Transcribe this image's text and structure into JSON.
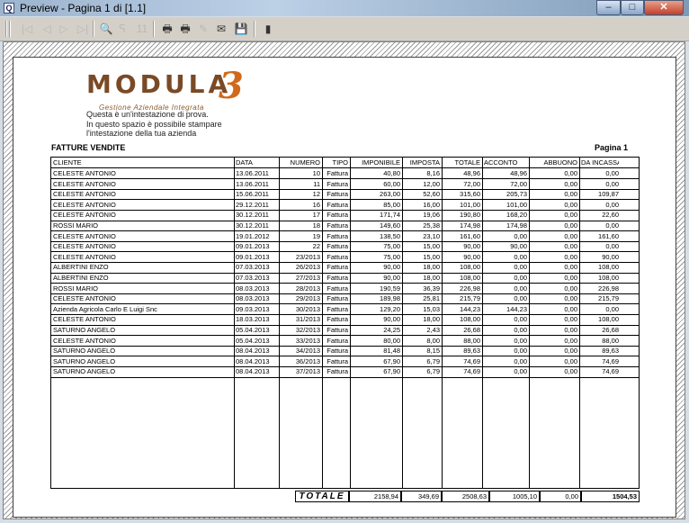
{
  "window": {
    "title": "Preview - Pagina 1 di [1.1]",
    "icon_glyph": "Q",
    "buttons": {
      "minimize": "–",
      "maximize": "□",
      "close": "✕"
    }
  },
  "toolbar": {
    "buttons": [
      {
        "name": "first-page-icon",
        "glyph": "|◁",
        "enabled": false
      },
      {
        "name": "prev-page-icon",
        "glyph": "◁",
        "enabled": false
      },
      {
        "name": "next-page-icon",
        "glyph": "▷",
        "enabled": false
      },
      {
        "name": "last-page-icon",
        "glyph": "▷|",
        "enabled": false
      },
      {
        "name": "zoom-icon",
        "glyph": "🔍",
        "enabled": true
      },
      {
        "name": "find-icon",
        "glyph": "ᕋ",
        "enabled": false
      },
      {
        "name": "find-next-icon",
        "glyph": "11",
        "enabled": false
      },
      {
        "name": "print-icon",
        "glyph": "🖶",
        "enabled": true
      },
      {
        "name": "print-setup-icon",
        "glyph": "🖶",
        "enabled": true
      },
      {
        "name": "export-icon",
        "glyph": "✎",
        "enabled": false
      },
      {
        "name": "email-icon",
        "glyph": "✉",
        "enabled": true
      },
      {
        "name": "save-icon",
        "glyph": "💾",
        "enabled": true
      },
      {
        "name": "close-preview-icon",
        "glyph": "▮",
        "enabled": true
      }
    ]
  },
  "report": {
    "logo": {
      "name": "MODULA",
      "digit": "3",
      "tagline": "Gestione Aziendale Integrata"
    },
    "intro_lines": [
      "Questa è un'intestazione di prova.",
      "In questo spazio è possibile stampare",
      "l'intestazione della tua azienda"
    ],
    "title": "FATTURE VENDITE",
    "page_label": "Pagina 1",
    "columns": [
      "CLIENTE",
      "DATA",
      "NUMERO",
      "TIPO",
      "IMPONIBILE",
      "IMPOSTA",
      "TOTALE",
      "ACCONTO",
      "ABBUONO",
      "DA INCASSARE"
    ],
    "rows": [
      [
        "CELESTE ANTONIO",
        "13.06.2011",
        "10",
        "Fattura",
        "40,80",
        "8,16",
        "48,96",
        "48,96",
        "0,00",
        "0,00"
      ],
      [
        "CELESTE ANTONIO",
        "13.06.2011",
        "11",
        "Fattura",
        "60,00",
        "12,00",
        "72,00",
        "72,00",
        "0,00",
        "0,00"
      ],
      [
        "CELESTE ANTONIO",
        "15.06.2011",
        "12",
        "Fattura",
        "263,00",
        "52,60",
        "315,60",
        "205,73",
        "0,00",
        "109,87"
      ],
      [
        "CELESTE ANTONIO",
        "29.12.2011",
        "16",
        "Fattura",
        "85,00",
        "16,00",
        "101,00",
        "101,00",
        "0,00",
        "0,00"
      ],
      [
        "CELESTE ANTONIO",
        "30.12.2011",
        "17",
        "Fattura",
        "171,74",
        "19,06",
        "190,80",
        "168,20",
        "0,00",
        "22,60"
      ],
      [
        "ROSSI MARIO",
        "30.12.2011",
        "18",
        "Fattura",
        "149,60",
        "25,38",
        "174,98",
        "174,98",
        "0,00",
        "0,00"
      ],
      [
        "CELESTE ANTONIO",
        "19.01.2012",
        "19",
        "Fattura",
        "138,50",
        "23,10",
        "161,60",
        "0,00",
        "0,00",
        "161,60"
      ],
      [
        "CELESTE ANTONIO",
        "09.01.2013",
        "22",
        "Fattura",
        "75,00",
        "15,00",
        "90,00",
        "90,00",
        "0,00",
        "0,00"
      ],
      [
        "CELESTE ANTONIO",
        "09.01.2013",
        "23/2013",
        "Fattura",
        "75,00",
        "15,00",
        "90,00",
        "0,00",
        "0,00",
        "90,00"
      ],
      [
        "ALBERTINI ENZO",
        "07.03.2013",
        "26/2013",
        "Fattura",
        "90,00",
        "18,00",
        "108,00",
        "0,00",
        "0,00",
        "108,00"
      ],
      [
        "ALBERTINI ENZO",
        "07.03.2013",
        "27/2013",
        "Fattura",
        "90,00",
        "18,00",
        "108,00",
        "0,00",
        "0,00",
        "108,00"
      ],
      [
        "ROSSI MARIO",
        "08.03.2013",
        "28/2013",
        "Fattura",
        "190,59",
        "36,39",
        "226,98",
        "0,00",
        "0,00",
        "226,98"
      ],
      [
        "CELESTE ANTONIO",
        "08.03.2013",
        "29/2013",
        "Fattura",
        "189,98",
        "25,81",
        "215,79",
        "0,00",
        "0,00",
        "215,79"
      ],
      [
        "Azienda Agricola Carlo E Luigi Snc",
        "09.03.2013",
        "30/2013",
        "Fattura",
        "129,20",
        "15,03",
        "144,23",
        "144,23",
        "0,00",
        "0,00"
      ],
      [
        "CELESTE ANTONIO",
        "18.03.2013",
        "31/2013",
        "Fattura",
        "90,00",
        "18,00",
        "108,00",
        "0,00",
        "0,00",
        "108,00"
      ],
      [
        "SATURNO ANGELO",
        "05.04.2013",
        "32/2013",
        "Fattura",
        "24,25",
        "2,43",
        "26,68",
        "0,00",
        "0,00",
        "26,68"
      ],
      [
        "CELESTE ANTONIO",
        "05.04.2013",
        "33/2013",
        "Fattura",
        "80,00",
        "8,00",
        "88,00",
        "0,00",
        "0,00",
        "88,00"
      ],
      [
        "SATURNO ANGELO",
        "08.04.2013",
        "34/2013",
        "Fattura",
        "81,48",
        "8,15",
        "89,63",
        "0,00",
        "0,00",
        "89,63"
      ],
      [
        "SATURNO ANGELO",
        "08.04.2013",
        "36/2013",
        "Fattura",
        "67,90",
        "6,79",
        "74,69",
        "0,00",
        "0,00",
        "74,69"
      ],
      [
        "SATURNO ANGELO",
        "08.04.2013",
        "37/2013",
        "Fattura",
        "67,90",
        "6,79",
        "74,69",
        "0,00",
        "0,00",
        "74,69"
      ]
    ],
    "totals": {
      "label": "TOTALE",
      "imponibile": "2158,94",
      "imposta": "349,69",
      "totale": "2508,63",
      "acconto": "1005,10",
      "abbuono": "0,00",
      "da_incassare": "1504,53"
    }
  }
}
